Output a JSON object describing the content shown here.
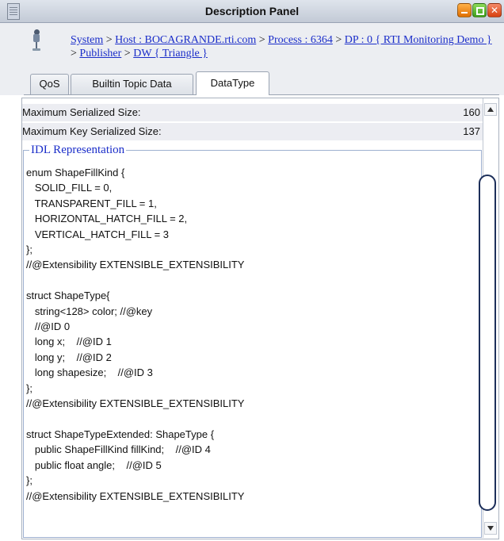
{
  "window": {
    "title": "Description Panel"
  },
  "breadcrumb": {
    "items": [
      {
        "label": "System"
      },
      {
        "label": "Host : BOCAGRANDE.rti.com"
      },
      {
        "label": "Process : 6364"
      },
      {
        "label": "DP : 0 { RTI Monitoring Demo }"
      },
      {
        "label": "Publisher"
      },
      {
        "label": "DW { Triangle }"
      }
    ],
    "separator": ">"
  },
  "tabs": [
    {
      "label": "QoS"
    },
    {
      "label": "Builtin Topic Data"
    },
    {
      "label": "DataType",
      "selected": true
    }
  ],
  "properties": [
    {
      "label": "Maximum Serialized Size:",
      "value": "160"
    },
    {
      "label": "Maximum Key Serialized Size:",
      "value": "137"
    }
  ],
  "idl": {
    "legend": "IDL Representation",
    "code": "enum ShapeFillKind {\n   SOLID_FILL = 0,\n   TRANSPARENT_FILL = 1,\n   HORIZONTAL_HATCH_FILL = 2,\n   VERTICAL_HATCH_FILL = 3\n};\n//@Extensibility EXTENSIBLE_EXTENSIBILITY\n\nstruct ShapeType{\n   string<128> color; //@key\n   //@ID 0\n   long x;    //@ID 1\n   long y;    //@ID 2\n   long shapesize;    //@ID 3\n};\n//@Extensibility EXTENSIBLE_EXTENSIBILITY\n\nstruct ShapeTypeExtended: ShapeType {\n   public ShapeFillKind fillKind;    //@ID 4\n   public float angle;    //@ID 5\n};\n//@Extensibility EXTENSIBLE_EXTENSIBILITY"
  },
  "colors": {
    "link": "#1a2dc9",
    "legend": "#1a2dc9",
    "property_row_bg": "#ecedf2",
    "titlebar": "#c3cad6"
  },
  "icons": {
    "title": "document-icon",
    "breadcrumb": "pin-icon",
    "window_buttons": [
      "minimize-icon",
      "maximize-icon",
      "close-icon"
    ],
    "scroll": [
      "scroll-up-icon",
      "scroll-down-icon"
    ]
  }
}
